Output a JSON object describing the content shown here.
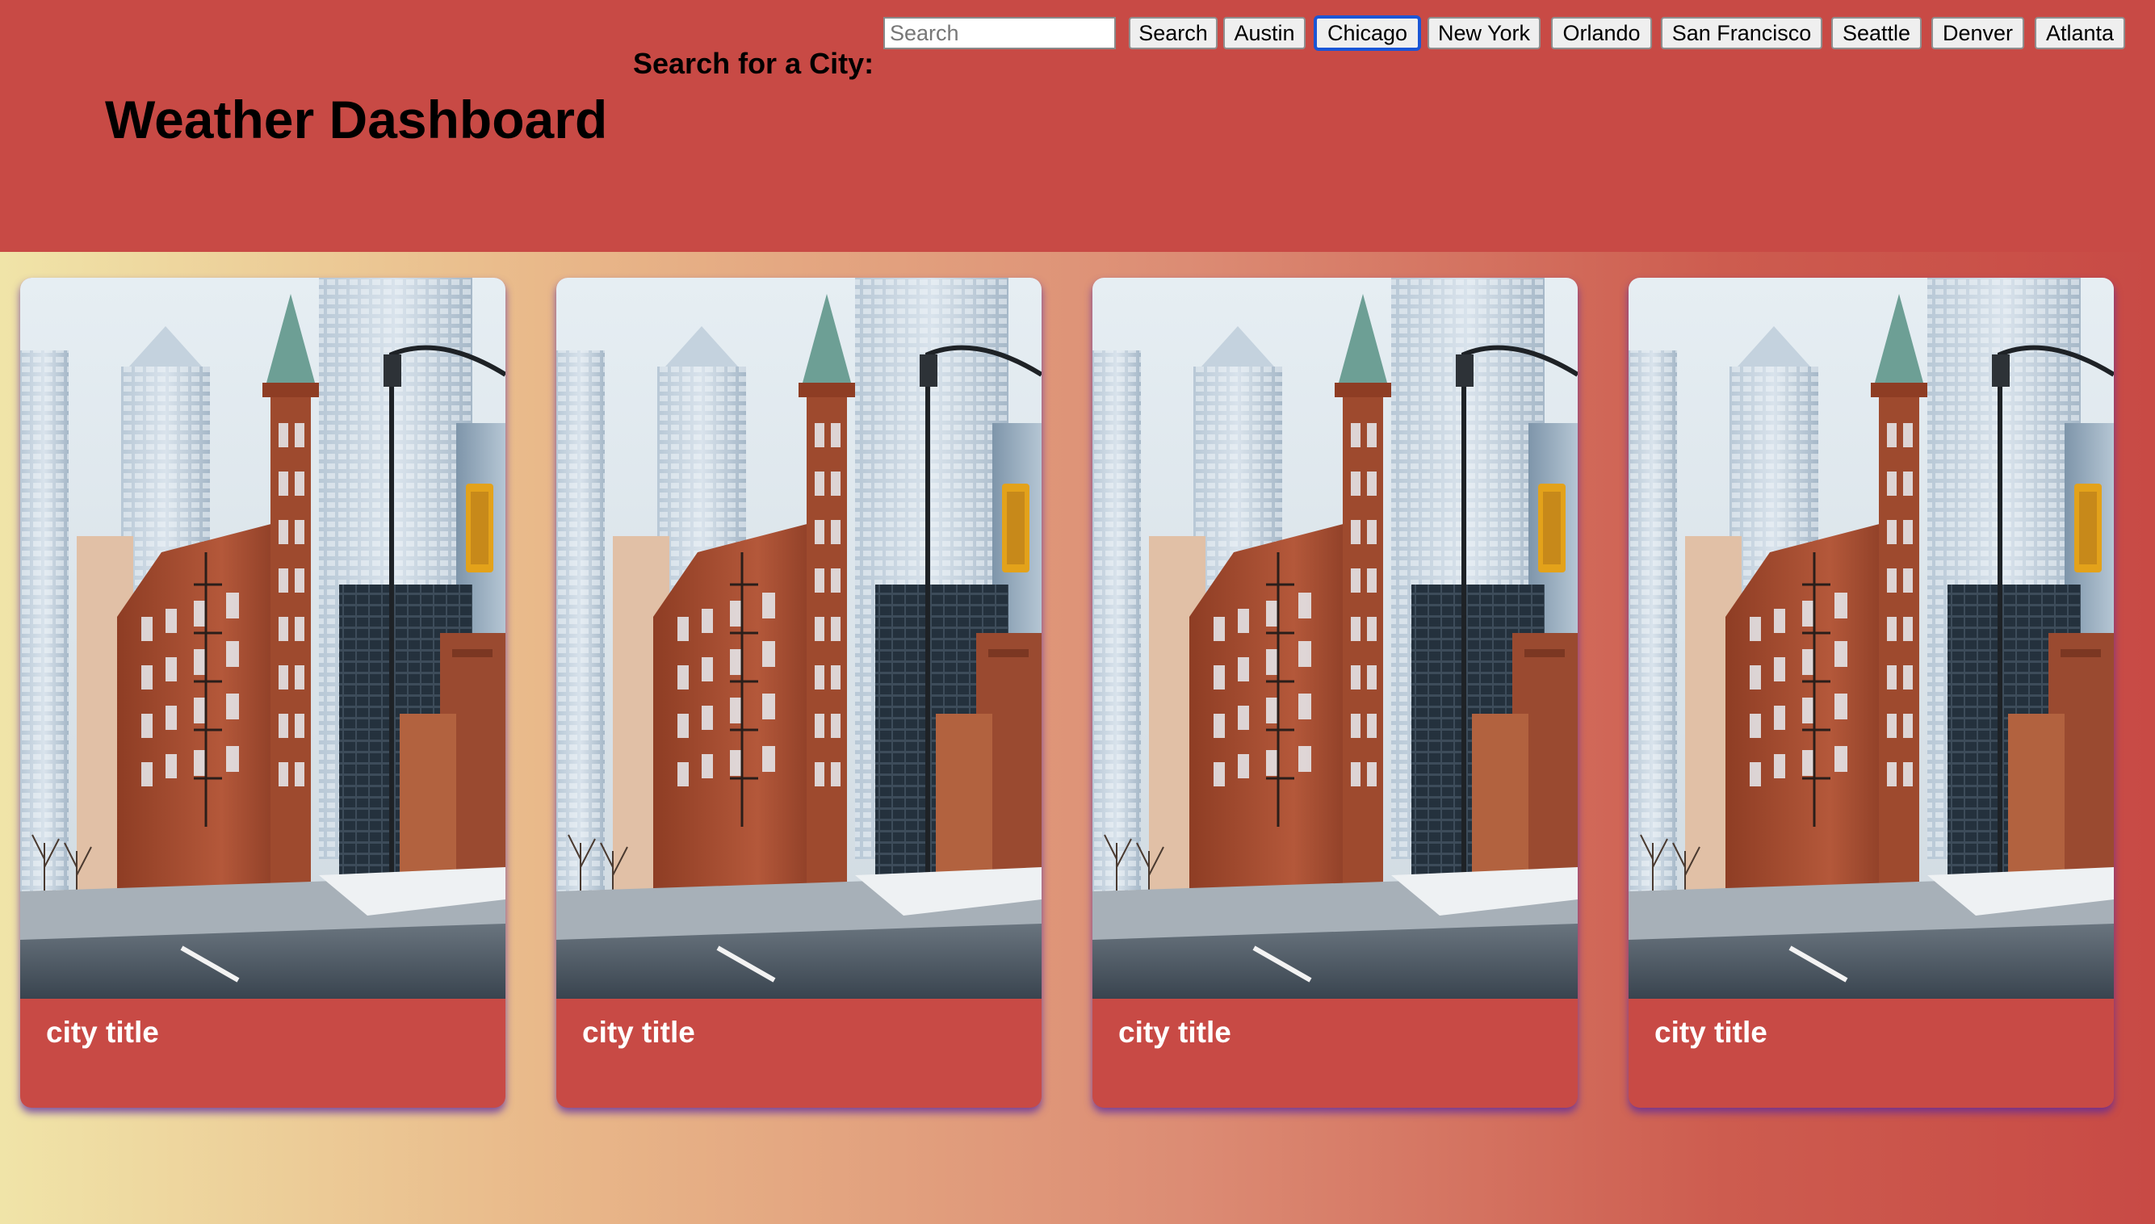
{
  "header": {
    "title": "Weather Dashboard",
    "search_label": "Search for a City:",
    "search_placeholder": "Search",
    "search_value": "",
    "search_button": "Search"
  },
  "cities": [
    {
      "label": "Austin",
      "focused": false
    },
    {
      "label": "Chicago",
      "focused": true
    },
    {
      "label": "New York",
      "focused": false
    },
    {
      "label": "Orlando",
      "focused": false
    },
    {
      "label": "San Francisco",
      "focused": false
    },
    {
      "label": "Seattle",
      "focused": false
    },
    {
      "label": "Denver",
      "focused": false
    },
    {
      "label": "Atlanta",
      "focused": false
    }
  ],
  "cards": [
    {
      "title": "city title",
      "image": "city-street-photo"
    },
    {
      "title": "city title",
      "image": "city-street-photo"
    },
    {
      "title": "city title",
      "image": "city-street-photo"
    },
    {
      "title": "city title",
      "image": "city-street-photo"
    }
  ],
  "colors": {
    "header_bg": "#c84a45",
    "card_bg": "#c84a45",
    "card_shadow": "#5a28a0",
    "focus_ring": "#1a56d6",
    "gradient_start": "#f0e4a8",
    "gradient_end": "#c84a45"
  }
}
